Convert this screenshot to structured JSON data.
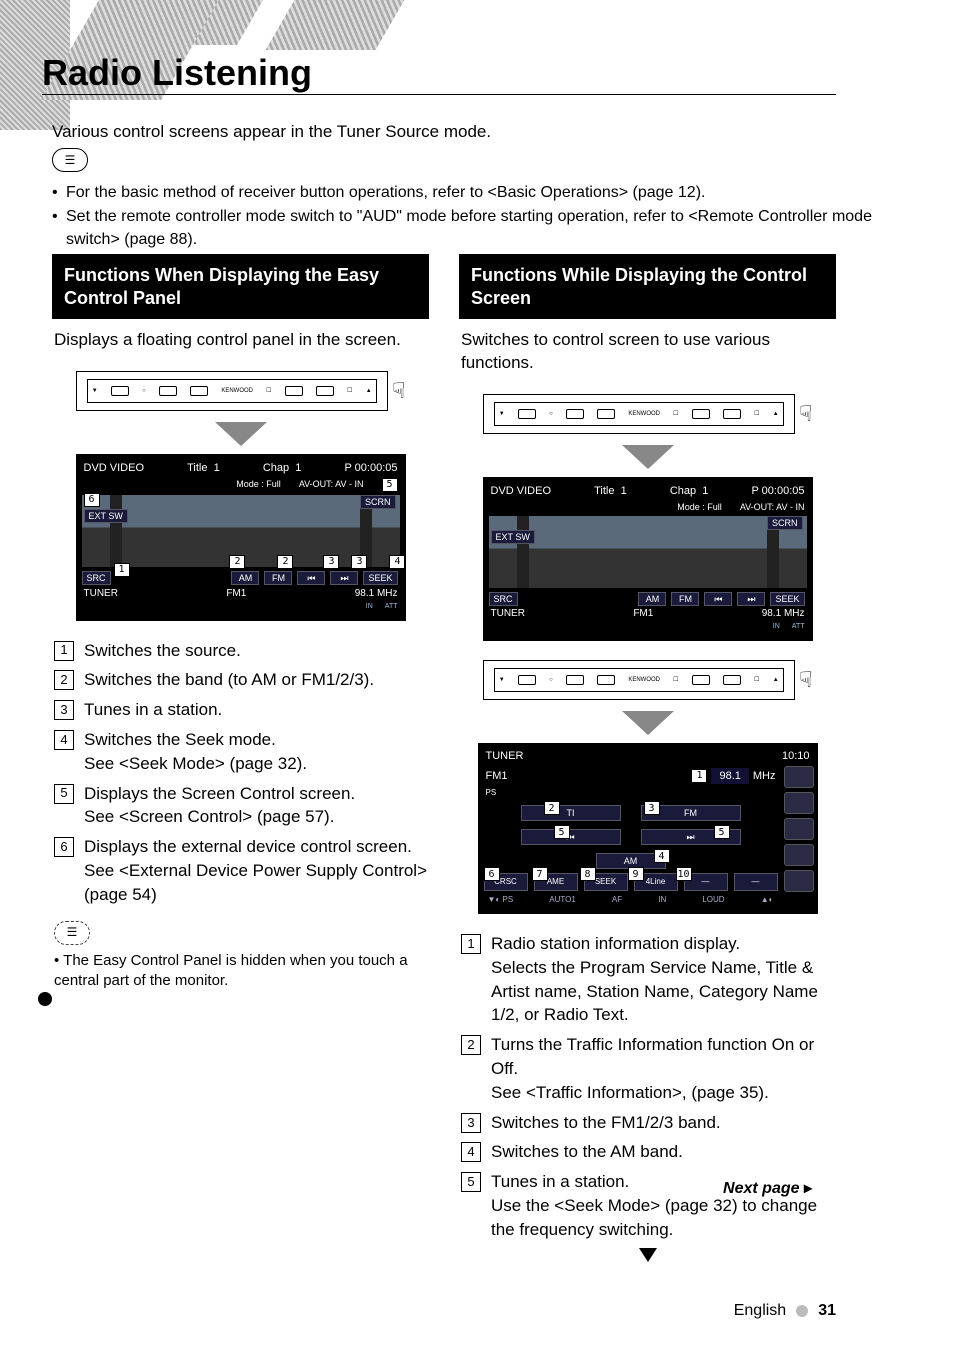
{
  "page_title": "Radio Listening",
  "intro": "Various control screens appear in the Tuner Source mode.",
  "notes": [
    "For the basic method of receiver button operations, refer to <Basic Operations> (page 12).",
    "Set the remote controller mode switch to \"AUD\" mode before starting operation, refer to <Remote Controller mode switch> (page 88)."
  ],
  "left": {
    "heading": "Functions When Displaying the Easy Control Panel",
    "description": "Displays a floating control panel in the screen.",
    "device_top": {
      "left": "DVD VIDEO",
      "title_lbl": "Title",
      "title_num": "1",
      "chap_lbl": "Chap",
      "chap_num": "1",
      "time": "P 00:00:05",
      "mode_lbl": "Mode :",
      "mode_val": "Full",
      "avout": "AV-OUT: AV - IN"
    },
    "device_side": {
      "extsw": "EXT SW",
      "scrn": "SCRN"
    },
    "device_bottom": {
      "src": "SRC",
      "tuner": "TUNER",
      "am": "AM",
      "fm": "FM",
      "fm1": "FM1",
      "prev": "⏮",
      "next": "⏭",
      "seek": "SEEK",
      "freq": "98.1 MHz",
      "in": "IN",
      "att": "ATT"
    },
    "callouts": [
      "1",
      "2",
      "2",
      "3",
      "3",
      "4",
      "5",
      "6"
    ],
    "items": [
      {
        "n": "1",
        "text": "Switches the source."
      },
      {
        "n": "2",
        "text": "Switches the band (to AM or FM1/2/3)."
      },
      {
        "n": "3",
        "text": "Tunes in a station."
      },
      {
        "n": "4",
        "text": "Switches the Seek mode.\nSee <Seek Mode> (page 32)."
      },
      {
        "n": "5",
        "text": "Displays the Screen Control screen.\nSee <Screen Control> (page 57)."
      },
      {
        "n": "6",
        "text": "Displays the external device control screen. See <External Device Power Supply Control> (page 54)"
      }
    ],
    "hint": "The Easy Control Panel is hidden when you touch a central part of the monitor."
  },
  "right": {
    "heading": "Functions While Displaying the Control Screen",
    "description": "Switches to control screen to use various functions.",
    "tuner": {
      "title": "TUNER",
      "clock": "10:10",
      "band": "FM1",
      "freq": "98.1",
      "unit": "MHz",
      "ps": "PS",
      "ti": "TI",
      "fm": "FM",
      "am": "AM",
      "prev": "⏮",
      "next": "⏭",
      "softkeys": [
        "CRSC",
        "AME",
        "SEEK",
        "4Line",
        "—",
        "—"
      ],
      "footer": {
        "ps": "PS",
        "auto": "AUTO1",
        "af": "AF",
        "in": "IN",
        "loud": "LOUD"
      }
    },
    "callouts": [
      "1",
      "2",
      "3",
      "4",
      "5",
      "5",
      "6",
      "7",
      "8",
      "9",
      "10"
    ],
    "items": [
      {
        "n": "1",
        "text": "Radio station information display.\nSelects the Program Service Name, Title & Artist name, Station Name, Category Name 1/2, or Radio Text."
      },
      {
        "n": "2",
        "text": "Turns the Traffic Information function On or Off.\nSee <Traffic Information>, (page 35)."
      },
      {
        "n": "3",
        "text": "Switches to the FM1/2/3 band."
      },
      {
        "n": "4",
        "text": "Switches to the AM band."
      },
      {
        "n": "5",
        "text": "Tunes in a station.\nUse the <Seek Mode> (page 32) to change the frequency switching."
      }
    ]
  },
  "faceplate_brand": "KENWOOD",
  "next_page": "Next page",
  "footer_lang": "English",
  "page_number": "31"
}
